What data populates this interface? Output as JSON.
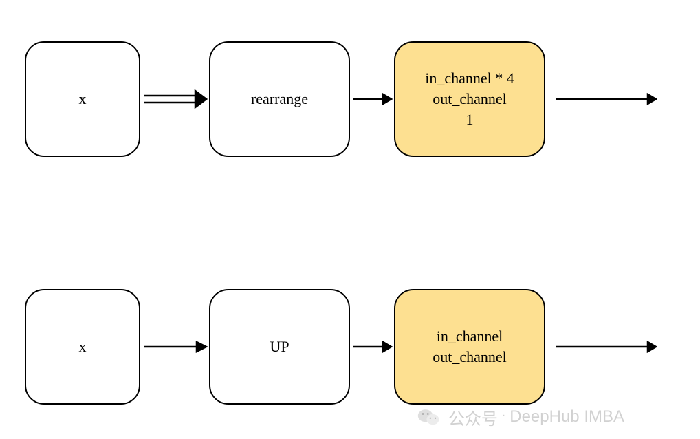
{
  "rows": [
    {
      "input_label": "x",
      "middle_label": "rearrange",
      "output_lines": {
        "l1": "in_channel * 4",
        "l2": "out_channel",
        "l3": "1"
      },
      "arrow1_type": "double"
    },
    {
      "input_label": "x",
      "middle_label": "UP",
      "output_lines": {
        "l1": "in_channel",
        "l2": "out_channel",
        "l3": ""
      },
      "arrow1_type": "single"
    }
  ],
  "watermark": {
    "prefix": "公众号",
    "suffix": "DeepHub IMBA"
  }
}
